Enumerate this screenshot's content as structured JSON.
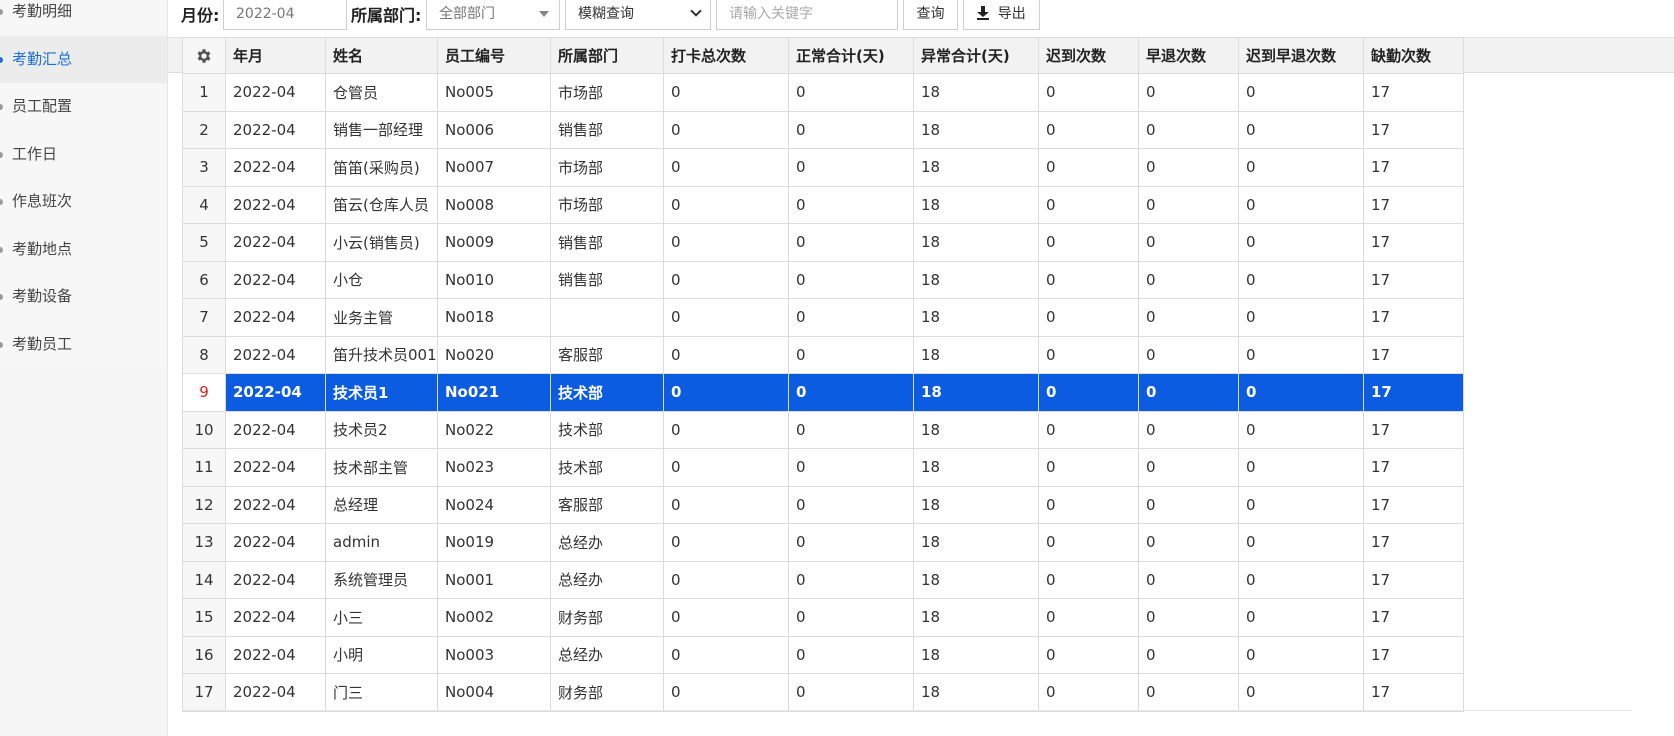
{
  "sidebar": {
    "items": [
      {
        "label": "考勤明细",
        "active": false
      },
      {
        "label": "考勤汇总",
        "active": true
      },
      {
        "label": "员工配置",
        "active": false
      },
      {
        "label": "工作日",
        "active": false
      },
      {
        "label": "作息班次",
        "active": false
      },
      {
        "label": "考勤地点",
        "active": false
      },
      {
        "label": "考勤设备",
        "active": false
      },
      {
        "label": "考勤员工",
        "active": false
      }
    ]
  },
  "toolbar": {
    "month_label": "月份:",
    "month_value": "2022-04",
    "dept_label": "所属部门:",
    "dept_value": "全部部门",
    "query_mode_value": "模糊查询",
    "keyword_placeholder": "请输入关键字",
    "search_label": "查询",
    "export_label": "导出"
  },
  "table": {
    "columns": [
      "年月",
      "姓名",
      "员工编号",
      "所属部门",
      "打卡总次数",
      "正常合计(天)",
      "异常合计(天)",
      "迟到次数",
      "早退次数",
      "迟到早退次数",
      "缺勤次数"
    ],
    "selected_index": 9,
    "rows": [
      {
        "n": "1",
        "ym": "2022-04",
        "name": "仓管员",
        "id": "No005",
        "dept": "市场部",
        "punch": "0",
        "normal": "0",
        "abnormal": "18",
        "late": "0",
        "early": "0",
        "lateearly": "0",
        "absent": "17"
      },
      {
        "n": "2",
        "ym": "2022-04",
        "name": "销售一部经理",
        "id": "No006",
        "dept": "销售部",
        "punch": "0",
        "normal": "0",
        "abnormal": "18",
        "late": "0",
        "early": "0",
        "lateearly": "0",
        "absent": "17"
      },
      {
        "n": "3",
        "ym": "2022-04",
        "name": "笛笛(采购员)",
        "id": "No007",
        "dept": "市场部",
        "punch": "0",
        "normal": "0",
        "abnormal": "18",
        "late": "0",
        "early": "0",
        "lateearly": "0",
        "absent": "17"
      },
      {
        "n": "4",
        "ym": "2022-04",
        "name": "笛云(仓库人员",
        "id": "No008",
        "dept": "市场部",
        "punch": "0",
        "normal": "0",
        "abnormal": "18",
        "late": "0",
        "early": "0",
        "lateearly": "0",
        "absent": "17"
      },
      {
        "n": "5",
        "ym": "2022-04",
        "name": "小云(销售员)",
        "id": "No009",
        "dept": "销售部",
        "punch": "0",
        "normal": "0",
        "abnormal": "18",
        "late": "0",
        "early": "0",
        "lateearly": "0",
        "absent": "17"
      },
      {
        "n": "6",
        "ym": "2022-04",
        "name": "小仓",
        "id": "No010",
        "dept": "销售部",
        "punch": "0",
        "normal": "0",
        "abnormal": "18",
        "late": "0",
        "early": "0",
        "lateearly": "0",
        "absent": "17"
      },
      {
        "n": "7",
        "ym": "2022-04",
        "name": "业务主管",
        "id": "No018",
        "dept": "",
        "punch": "0",
        "normal": "0",
        "abnormal": "18",
        "late": "0",
        "early": "0",
        "lateearly": "0",
        "absent": "17"
      },
      {
        "n": "8",
        "ym": "2022-04",
        "name": "笛升技术员001",
        "id": "No020",
        "dept": "客服部",
        "punch": "0",
        "normal": "0",
        "abnormal": "18",
        "late": "0",
        "early": "0",
        "lateearly": "0",
        "absent": "17"
      },
      {
        "n": "9",
        "ym": "2022-04",
        "name": "技术员1",
        "id": "No021",
        "dept": "技术部",
        "punch": "0",
        "normal": "0",
        "abnormal": "18",
        "late": "0",
        "early": "0",
        "lateearly": "0",
        "absent": "17"
      },
      {
        "n": "10",
        "ym": "2022-04",
        "name": "技术员2",
        "id": "No022",
        "dept": "技术部",
        "punch": "0",
        "normal": "0",
        "abnormal": "18",
        "late": "0",
        "early": "0",
        "lateearly": "0",
        "absent": "17"
      },
      {
        "n": "11",
        "ym": "2022-04",
        "name": "技术部主管",
        "id": "No023",
        "dept": "技术部",
        "punch": "0",
        "normal": "0",
        "abnormal": "18",
        "late": "0",
        "early": "0",
        "lateearly": "0",
        "absent": "17"
      },
      {
        "n": "12",
        "ym": "2022-04",
        "name": "总经理",
        "id": "No024",
        "dept": "客服部",
        "punch": "0",
        "normal": "0",
        "abnormal": "18",
        "late": "0",
        "early": "0",
        "lateearly": "0",
        "absent": "17"
      },
      {
        "n": "13",
        "ym": "2022-04",
        "name": "admin",
        "id": "No019",
        "dept": "总经办",
        "punch": "0",
        "normal": "0",
        "abnormal": "18",
        "late": "0",
        "early": "0",
        "lateearly": "0",
        "absent": "17"
      },
      {
        "n": "14",
        "ym": "2022-04",
        "name": "系统管理员",
        "id": "No001",
        "dept": "总经办",
        "punch": "0",
        "normal": "0",
        "abnormal": "18",
        "late": "0",
        "early": "0",
        "lateearly": "0",
        "absent": "17"
      },
      {
        "n": "15",
        "ym": "2022-04",
        "name": "小三",
        "id": "No002",
        "dept": "财务部",
        "punch": "0",
        "normal": "0",
        "abnormal": "18",
        "late": "0",
        "early": "0",
        "lateearly": "0",
        "absent": "17"
      },
      {
        "n": "16",
        "ym": "2022-04",
        "name": "小明",
        "id": "No003",
        "dept": "总经办",
        "punch": "0",
        "normal": "0",
        "abnormal": "18",
        "late": "0",
        "early": "0",
        "lateearly": "0",
        "absent": "17"
      },
      {
        "n": "17",
        "ym": "2022-04",
        "name": "门三",
        "id": "No004",
        "dept": "财务部",
        "punch": "0",
        "normal": "0",
        "abnormal": "18",
        "late": "0",
        "early": "0",
        "lateearly": "0",
        "absent": "17"
      }
    ]
  },
  "colors": {
    "selected_row": "#0b5ce1",
    "link_value": "#2b78c5",
    "active_menu": "#1a6fd6"
  },
  "icons": {
    "settings": "gear-icon",
    "export": "download-icon",
    "dept_dropdown": "caret-down-icon",
    "mode_dropdown": "chevron-down-icon"
  }
}
